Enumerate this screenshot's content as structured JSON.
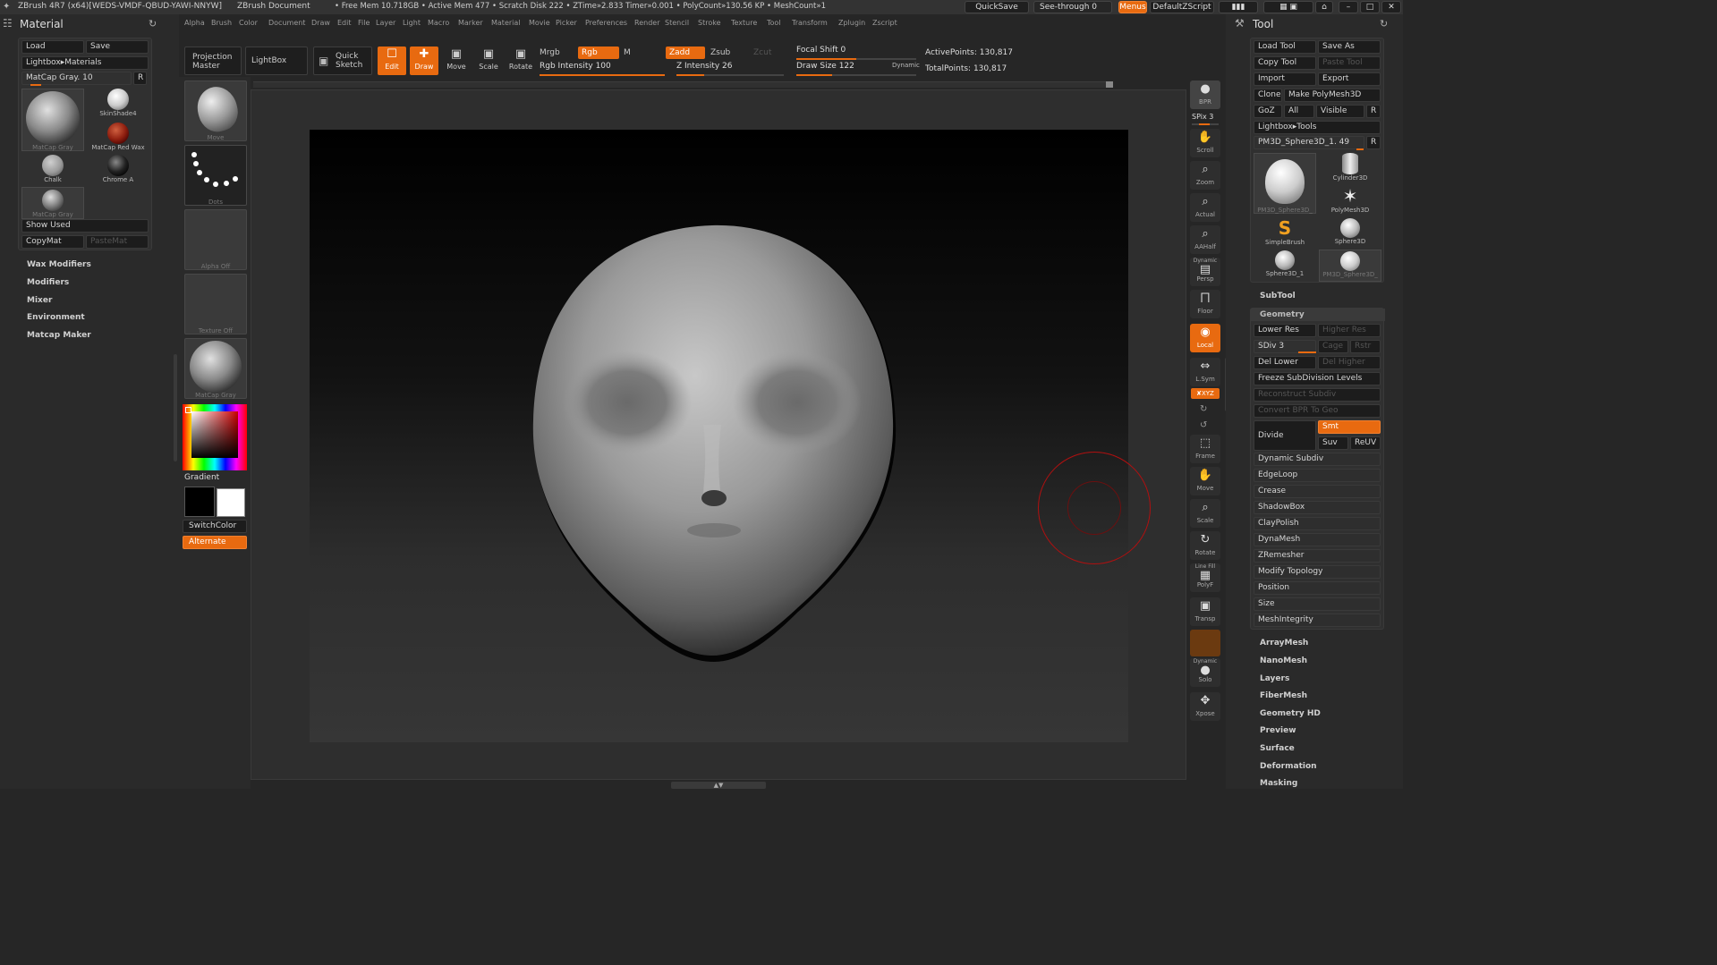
{
  "titlebar": {
    "app": "ZBrush 4R7 (x64)[WEDS-VMDF-QBUD-YAWI-NNYW]",
    "doc": "ZBrush Document",
    "stats": "• Free Mem 10.718GB • Active Mem 477 • Scratch Disk 222 •  ZTime»2.833 Timer»0.001 • PolyCount»130.56 KP  • MeshCount»1",
    "quicksave": "QuickSave",
    "seethrough": "See-through  0",
    "menus": "Menus",
    "defaultzscript": "DefaultZScript"
  },
  "menubar": [
    "Alpha",
    "Brush",
    "Color",
    "Document",
    "Draw",
    "Edit",
    "File",
    "Layer",
    "Light",
    "Macro",
    "Marker",
    "Material",
    "Movie",
    "Picker",
    "Preferences",
    "Render",
    "Stencil",
    "Stroke",
    "Texture",
    "Tool",
    "Transform",
    "Zplugin",
    "Zscript"
  ],
  "left": {
    "title": "Material",
    "load": "Load",
    "save": "Save",
    "lightbox": "Lightbox▸Materials",
    "matcap_slider": "MatCap Gray. 10",
    "r": "R",
    "materials": [
      "MatCap Gray",
      "SkinShade4",
      "MatCap Red Wax",
      "Chalk",
      "Chrome A",
      "MatCap Gray"
    ],
    "show_used": "Show Used",
    "copymat": "CopyMat",
    "pastemat": "PasteMat",
    "sections": [
      "Wax Modifiers",
      "Modifiers",
      "Mixer",
      "Environment",
      "Matcap Maker"
    ]
  },
  "brushcol": {
    "slots": [
      "Move",
      "Dots",
      "Alpha Off",
      "Texture Off",
      "MatCap Gray"
    ],
    "gradient": "Gradient",
    "switchcolor": "SwitchColor",
    "alternate": "Alternate"
  },
  "toolbar": {
    "projection_master": "Projection Master",
    "lightbox": "LightBox",
    "quick_sketch": "Quick Sketch",
    "edit": "Edit",
    "draw": "Draw",
    "move": "Move",
    "scale": "Scale",
    "rotate": "Rotate",
    "mrgb": "Mrgb",
    "rgb": "Rgb",
    "m": "M",
    "zadd": "Zadd",
    "zsub": "Zsub",
    "zcut": "Zcut",
    "rgb_intensity": "Rgb Intensity 100",
    "z_intensity": "Z Intensity 26",
    "focal_shift": "Focal Shift 0",
    "draw_size": "Draw Size 122",
    "dynamic": "Dynamic",
    "active_points": "ActivePoints: 130,817",
    "total_points": "TotalPoints: 130,817"
  },
  "rightnav": {
    "bpr": "BPR",
    "spix": "SPix 3",
    "scroll": "Scroll",
    "zoom": "Zoom",
    "actual": "Actual",
    "aahalf": "AAHalf",
    "dynamic_persp": "Dynamic",
    "persp": "Persp",
    "floor": "Floor",
    "local": "Local",
    "lsym": "L.Sym",
    "xyz": "✘XYZ",
    "frame": "Frame",
    "move": "Move",
    "scale": "Scale",
    "rotate": "Rotate",
    "linefill": "Line Fill",
    "polyf": "PolyF",
    "transp": "Transp",
    "dynamic_solo": "Dynamic",
    "solo": "Solo",
    "xpose": "Xpose"
  },
  "right": {
    "title": "Tool",
    "load_tool": "Load Tool",
    "save_as": "Save As",
    "copy_tool": "Copy Tool",
    "paste_tool": "Paste Tool",
    "import": "Import",
    "export": "Export",
    "clone": "Clone",
    "make_polymesh": "Make PolyMesh3D",
    "goz": "GoZ",
    "all": "All",
    "visible": "Visible",
    "r": "R",
    "lightbox_tools": "Lightbox▸Tools",
    "current_tool": "PM3D_Sphere3D_1. 49",
    "tools": [
      "PM3D_Sphere3D_",
      "Cylinder3D",
      "PolyMesh3D",
      "SimpleBrush",
      "Sphere3D",
      "Sphere3D_1",
      "PM3D_Sphere3D_"
    ],
    "subtool": "SubTool",
    "geometry": "Geometry",
    "lower_res": "Lower Res",
    "higher_res": "Higher Res",
    "sdiv": "SDiv 3",
    "cage": "Cage",
    "rstr": "Rstr",
    "del_lower": "Del Lower",
    "del_higher": "Del Higher",
    "freeze": "Freeze SubDivision Levels",
    "reconstruct": "Reconstruct Subdiv",
    "convert_bpr": "Convert BPR To Geo",
    "divide": "Divide",
    "smt": "Smt",
    "suv": "Suv",
    "reuv": "ReUV",
    "geo_items": [
      "Dynamic Subdiv",
      "EdgeLoop",
      "Crease",
      "ShadowBox",
      "ClayPolish",
      "DynaMesh",
      "ZRemesher",
      "Modify Topology",
      "Position",
      "Size",
      "MeshIntegrity"
    ],
    "sections": [
      "ArrayMesh",
      "NanoMesh",
      "Layers",
      "FiberMesh",
      "Geometry HD",
      "Preview",
      "Surface",
      "Deformation",
      "Masking"
    ]
  },
  "colors": {
    "accent": "#e86a10",
    "panel": "#2a2a2a",
    "button": "#1c1c1c"
  },
  "levels": {
    "matcap_slider": 0.1,
    "rgb_intensity": 1.0,
    "z_intensity": 0.26,
    "focal_shift": 0.5,
    "draw_size": 0.3,
    "spix": 0.75
  }
}
